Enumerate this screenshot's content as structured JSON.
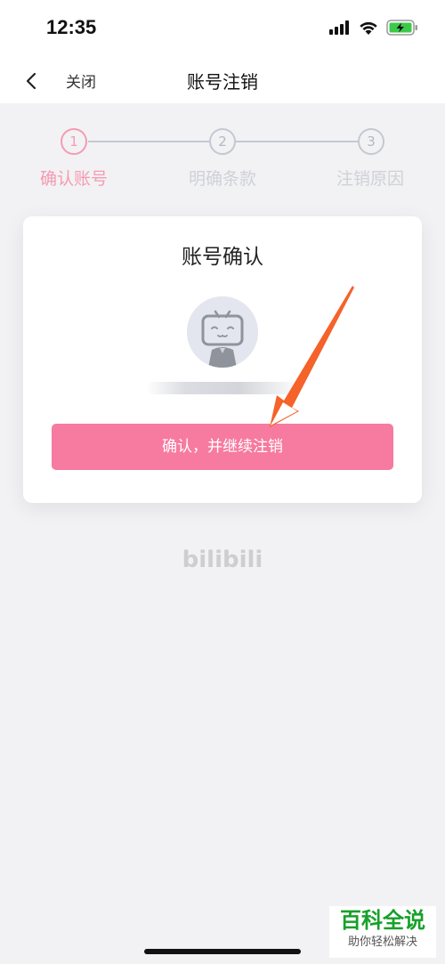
{
  "status_bar": {
    "time": "12:35",
    "icons": [
      "signal-icon",
      "wifi-icon",
      "battery-charging-icon"
    ]
  },
  "nav": {
    "back_icon": "chevron-left-icon",
    "close_label": "关闭",
    "title": "账号注销"
  },
  "steps": [
    {
      "number": "1",
      "label": "确认账号",
      "active": true
    },
    {
      "number": "2",
      "label": "明确条款",
      "active": false
    },
    {
      "number": "3",
      "label": "注销原因",
      "active": false
    }
  ],
  "card": {
    "title": "账号确认",
    "avatar_icon": "bilibili-tv-avatar-icon",
    "confirm_button": "确认，并继续注销"
  },
  "brand": {
    "logo_text": "bilibili"
  },
  "watermark": {
    "title": "百科全说",
    "subtitle": "助你轻松解决"
  },
  "colors": {
    "accent_pink": "#f77aa0",
    "step_active": "#f59bb2",
    "arrow_orange": "#f5622a",
    "watermark_green": "#17a02a"
  }
}
